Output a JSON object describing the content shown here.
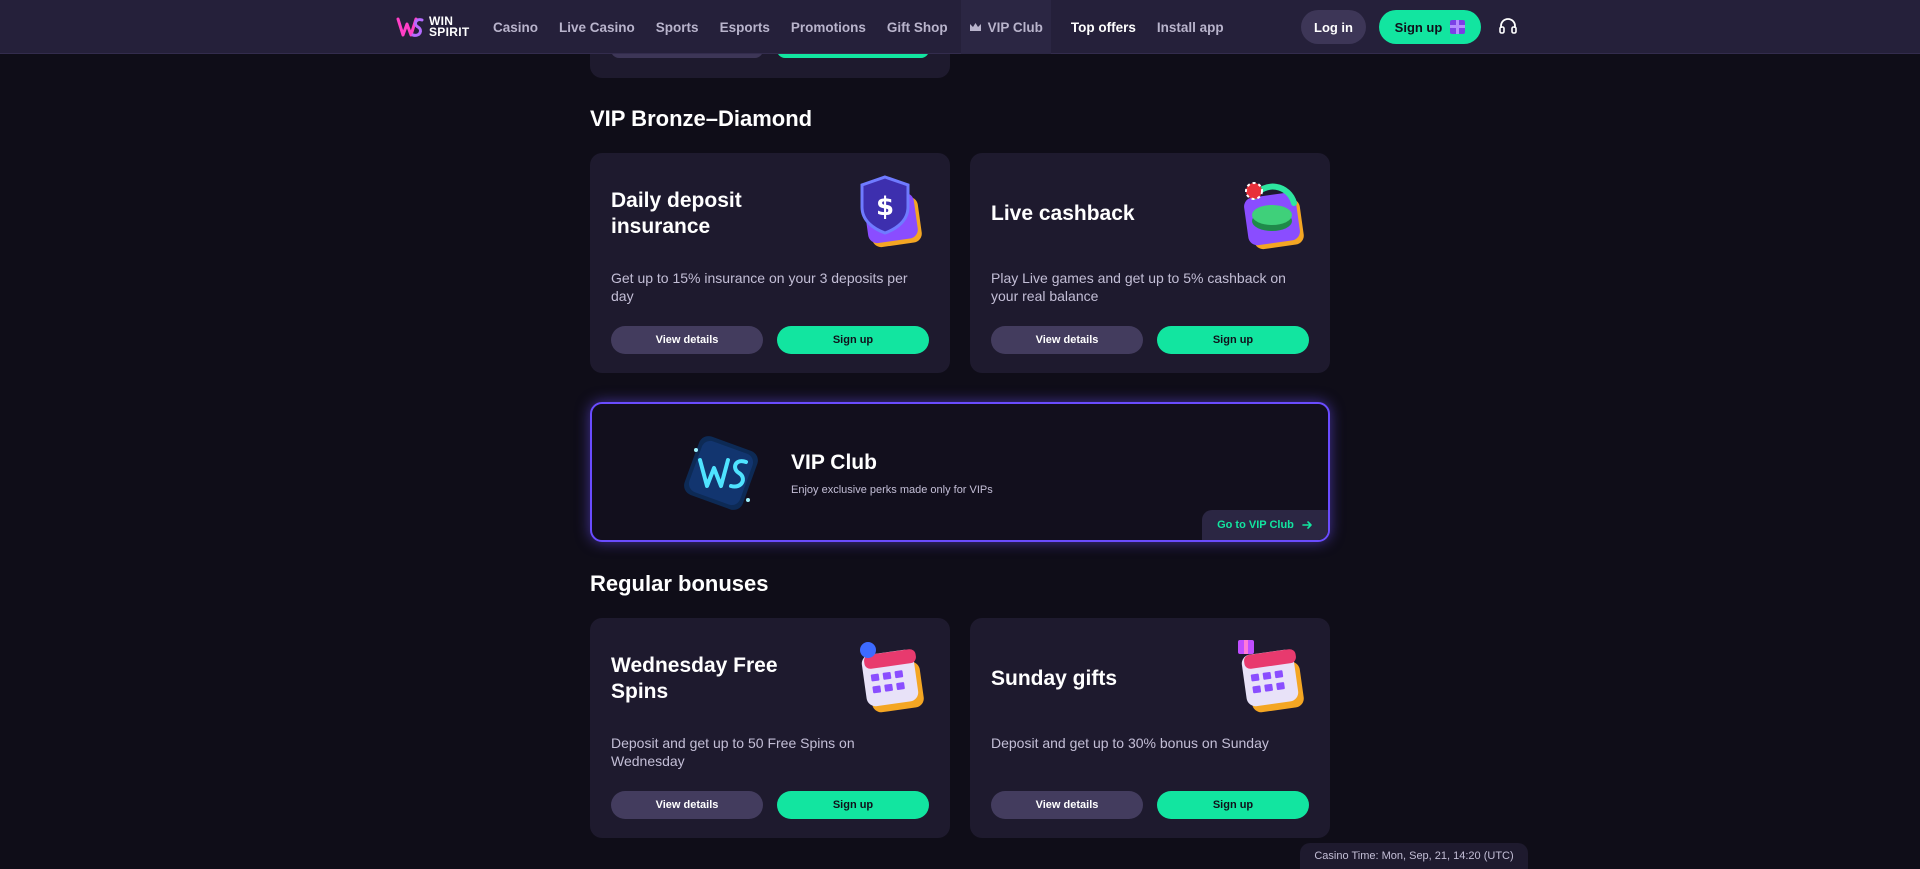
{
  "header": {
    "logo_line1": "WIN",
    "logo_line2": "SPIRIT",
    "nav": [
      {
        "label": "Casino"
      },
      {
        "label": "Live Casino"
      },
      {
        "label": "Sports"
      },
      {
        "label": "Esports"
      },
      {
        "label": "Promotions"
      },
      {
        "label": "Gift Shop"
      },
      {
        "label": "VIP Club",
        "icon": "crown-icon"
      },
      {
        "label": "Top offers"
      },
      {
        "label": "Install app"
      }
    ],
    "login_label": "Log in",
    "signup_label": "Sign up",
    "signup_icon": "gift-icon",
    "support_icon": "headset-icon"
  },
  "sections": {
    "vip_title": "VIP Bronze–Diamond",
    "regular_title": "Regular bonuses"
  },
  "cards": [
    {
      "title": "Daily deposit insurance",
      "desc": "Get up to 15% insurance on your 3 deposits per day",
      "details_label": "View details",
      "signup_label": "Sign up",
      "art": "shield-dollar-icon"
    },
    {
      "title": "Live cashback",
      "desc": "Play Live games and get up to 5% cashback on your real balance",
      "details_label": "View details",
      "signup_label": "Sign up",
      "art": "cashback-icon"
    },
    {
      "title": "Wednesday Free Spins",
      "desc": "Deposit and get up to 50 Free Spins on Wednesday",
      "details_label": "View details",
      "signup_label": "Sign up",
      "art": "calendar-icon"
    },
    {
      "title": "Sunday gifts",
      "desc": "Deposit and get up to 30% bonus on Sunday",
      "details_label": "View details",
      "signup_label": "Sign up",
      "art": "calendar-gift-icon"
    }
  ],
  "vip_banner": {
    "title": "VIP Club",
    "subtitle": "Enjoy exclusive perks made only for VIPs",
    "cta_label": "Go to VIP Club"
  },
  "footer": {
    "casino_time": "Casino Time: Mon, Sep, 21, 14:20 (UTC)"
  },
  "colors": {
    "background": "#0f0d18",
    "header": "#25203a",
    "card": "#1e1a2e",
    "accent_green": "#12e5a0",
    "secondary_button": "#433c5e",
    "vip_border": "#6a4cff"
  }
}
